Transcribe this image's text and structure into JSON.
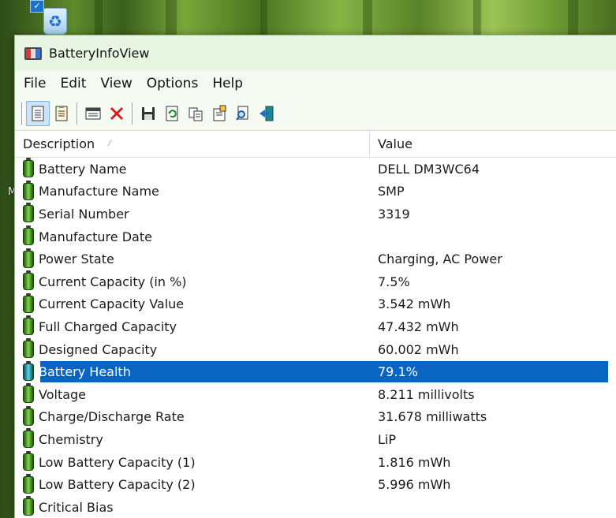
{
  "window": {
    "title": "BatteryInfoView"
  },
  "desktop": {
    "partial_label": "M"
  },
  "menu": [
    "File",
    "Edit",
    "View",
    "Options",
    "Help"
  ],
  "toolbar": {
    "icons": [
      "report-view-icon",
      "html-view-icon",
      "window-icon",
      "delete-icon",
      "save-icon",
      "refresh-icon",
      "copy-icon",
      "properties-icon",
      "find-icon",
      "exit-icon"
    ]
  },
  "columns": {
    "description": "Description",
    "value": "Value"
  },
  "rows": [
    {
      "description": "Battery Name",
      "value": "DELL DM3WC64"
    },
    {
      "description": "Manufacture Name",
      "value": "SMP"
    },
    {
      "description": "Serial Number",
      "value": "3319"
    },
    {
      "description": "Manufacture Date",
      "value": ""
    },
    {
      "description": "Power State",
      "value": "Charging, AC Power"
    },
    {
      "description": "Current Capacity (in %)",
      "value": "7.5%"
    },
    {
      "description": "Current Capacity Value",
      "value": "3.542 mWh"
    },
    {
      "description": "Full Charged Capacity",
      "value": "47.432 mWh"
    },
    {
      "description": "Designed Capacity",
      "value": "60.002 mWh"
    },
    {
      "description": "Battery Health",
      "value": "79.1%"
    },
    {
      "description": "Voltage",
      "value": "8.211 millivolts"
    },
    {
      "description": "Charge/Discharge Rate",
      "value": "31.678 milliwatts"
    },
    {
      "description": "Chemistry",
      "value": "LiP"
    },
    {
      "description": "Low Battery Capacity (1)",
      "value": "1.816 mWh"
    },
    {
      "description": "Low Battery Capacity (2)",
      "value": "5.996 mWh"
    },
    {
      "description": "Critical Bias",
      "value": ""
    }
  ],
  "selected_row": 9,
  "colors": {
    "selection": "#0a64c2",
    "titlebar": "#e9f5e3"
  }
}
